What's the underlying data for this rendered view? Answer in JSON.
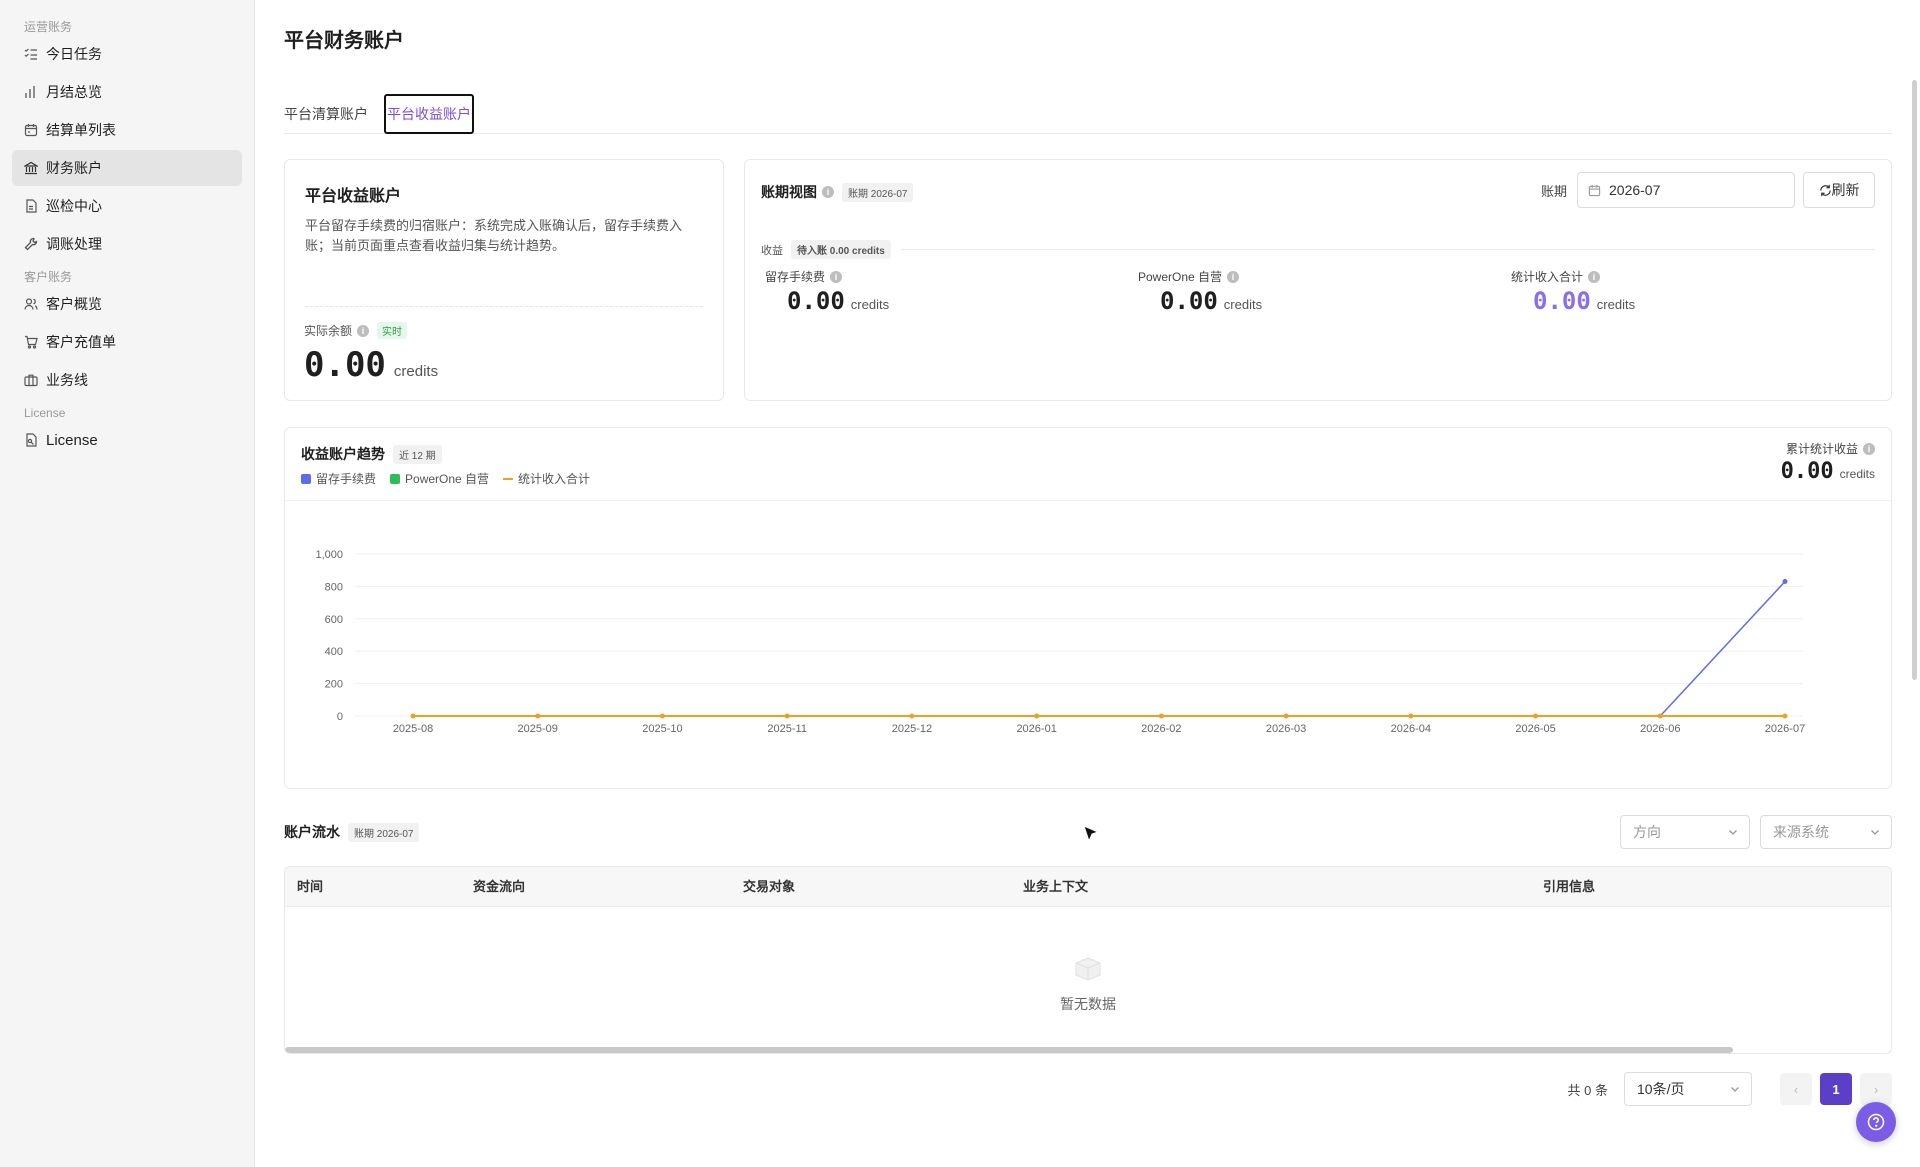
{
  "sidebar": {
    "groups": [
      {
        "label": "运营账务",
        "items": [
          {
            "label": "今日任务",
            "icon": "checklist-icon"
          },
          {
            "label": "月结总览",
            "icon": "bar-chart-icon"
          },
          {
            "label": "结算单列表",
            "icon": "calendar-icon"
          },
          {
            "label": "财务账户",
            "icon": "bank-icon",
            "active": true
          },
          {
            "label": "巡检中心",
            "icon": "document-icon"
          },
          {
            "label": "调账处理",
            "icon": "wrench-icon"
          }
        ]
      },
      {
        "label": "客户账务",
        "items": [
          {
            "label": "客户概览",
            "icon": "users-icon"
          },
          {
            "label": "客户充值单",
            "icon": "cart-icon"
          },
          {
            "label": "业务线",
            "icon": "briefcase-icon"
          }
        ]
      },
      {
        "label": "License",
        "items": [
          {
            "label": "License",
            "icon": "license-icon"
          }
        ]
      }
    ]
  },
  "page": {
    "title": "平台财务账户",
    "tabs": [
      "平台清算账户",
      "平台收益账户"
    ],
    "active_tab": "平台收益账户"
  },
  "info_card": {
    "title": "平台收益账户",
    "desc": "平台留存手续费的归宿账户：系统完成入账确认后，留存手续费入账；当前页面重点查看收益归集与统计趋势。",
    "balance_label": "实际余额",
    "live_badge": "实时",
    "balance": "0.00",
    "unit": "credits"
  },
  "period_view": {
    "title": "账期视图",
    "period_tag": "账期 2026-07",
    "period_label": "账期",
    "period_value": "2026-07",
    "refresh_label": "刷新",
    "income_label": "收益",
    "pending_tag": "待入账 0.00 credits",
    "metrics": [
      {
        "label": "留存手续费",
        "value": "0.00",
        "unit": "credits",
        "color": "#111111"
      },
      {
        "label": "PowerOne 自营",
        "value": "0.00",
        "unit": "credits",
        "color": "#111111"
      },
      {
        "label": "统计收入合计",
        "value": "0.00",
        "unit": "credits",
        "color": "#8a6ef0"
      }
    ]
  },
  "trend": {
    "title": "收益账户趋势",
    "tag": "近 12 期",
    "cumulative_label": "累计统计收益",
    "cumulative_value": "0.00",
    "cumulative_unit": "credits"
  },
  "chart_data": {
    "type": "line",
    "categories": [
      "2025-08",
      "2025-09",
      "2025-10",
      "2025-11",
      "2025-12",
      "2026-01",
      "2026-02",
      "2026-03",
      "2026-04",
      "2026-05",
      "2026-06",
      "2026-07"
    ],
    "series": [
      {
        "name": "留存手续费",
        "color": "#5b6ee8",
        "values": [
          0,
          0,
          0,
          0,
          0,
          0,
          0,
          0,
          0,
          0,
          0,
          830
        ]
      },
      {
        "name": "PowerOne 自营",
        "color": "#2dbd5a",
        "values": [
          0,
          0,
          0,
          0,
          0,
          0,
          0,
          0,
          0,
          0,
          0,
          0
        ]
      },
      {
        "name": "统计收入合计",
        "color": "#f0a020",
        "values": [
          0,
          0,
          0,
          0,
          0,
          0,
          0,
          0,
          0,
          0,
          0,
          0
        ]
      }
    ],
    "yticks": [
      "0",
      "200",
      "400",
      "600",
      "800",
      "1,000"
    ],
    "ylim": [
      0,
      1000
    ],
    "grid": true,
    "legend": "top-left"
  },
  "flow": {
    "title": "账户流水",
    "period_tag": "账期 2026-07",
    "direction_placeholder": "方向",
    "source_placeholder": "来源系统",
    "columns": [
      "时间",
      "资金流向",
      "交易对象",
      "业务上下文",
      "引用信息"
    ],
    "empty_text": "暂无数据"
  },
  "pagination": {
    "total": "共 0 条",
    "page_size": "10条/页",
    "current_page": "1",
    "prev": "‹",
    "next": "›"
  }
}
